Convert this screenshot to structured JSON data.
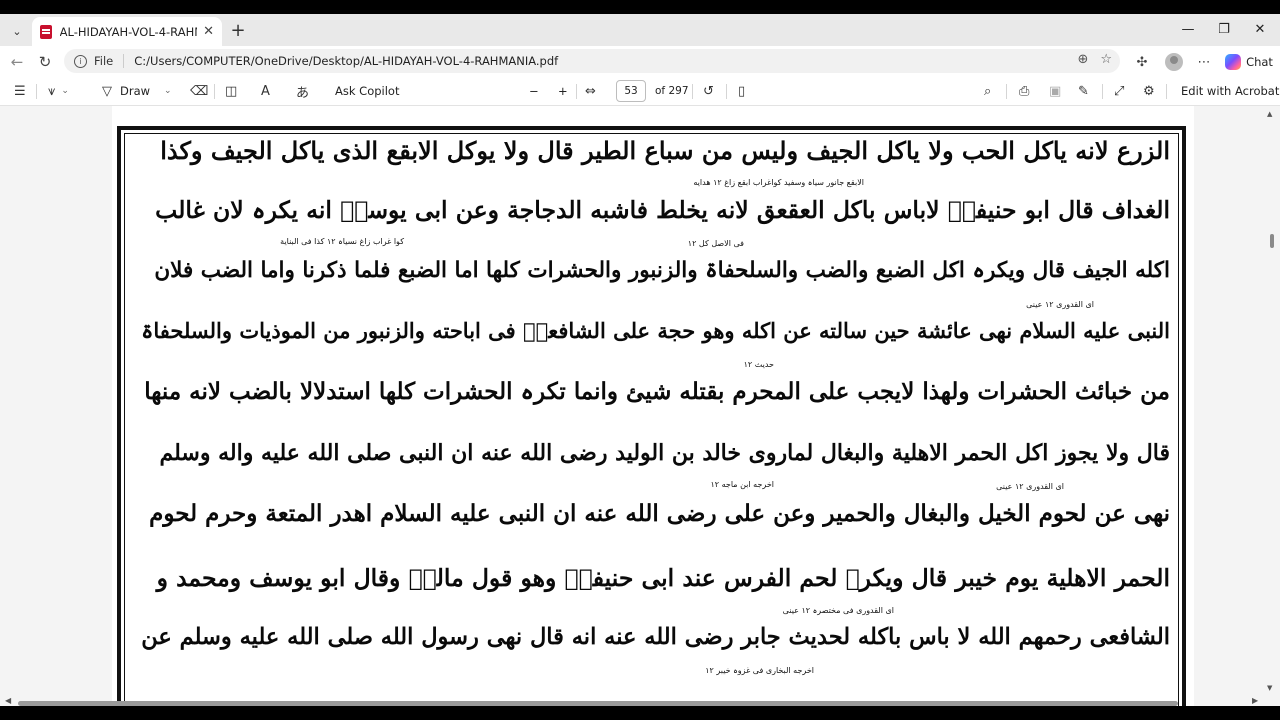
{
  "browser": {
    "tab_title": "AL-HIDAYAH-VOL-4-RAHMANIA.pdf",
    "tab_close": "✕",
    "new_tab": "+",
    "scheme_label": "File",
    "url": "C:/Users/COMPUTER/OneDrive/Desktop/AL-HIDAYAH-VOL-4-RAHMANIA.pdf",
    "chat_label": "Chat",
    "window_controls": {
      "minimize": "—",
      "maximize": "❐",
      "close": "✕"
    }
  },
  "pdf_toolbar": {
    "draw_label": "Draw",
    "ask_copilot_label": "Ask Copilot",
    "zoom_out": "−",
    "zoom_in": "+",
    "current_page": "53",
    "total_pages": "of 297",
    "edit_acrobat_label": "Edit with Acrobat"
  },
  "document": {
    "lines": [
      "الزرع لانه یاکل الحب ولا یاکل الجیف ولیس من سباع الطیر قال ولا یوکل الابقع الذی یاکل الجیف وکذا",
      "الغداف قال ابو حنیفہؒ لاباس باکل العقعق لانه یخلط فاشبه الدجاجة وعن ابی یوسفؒ انه یکرہ لان غالب",
      "اکله الجیف قال ویکرہ اکل الضبع والضب والسلحفاۃ والزنبور والحشرات کلها اما الضبع فلما ذکرنا واما الضب فلان",
      "النبی علیه السلام نهی عائشة حین سالته عن اکله وهو حجة علی الشافعیؒ فی اباحته والزنبور من الموذیات والسلحفاۃ",
      "من خبائث الحشرات ولهذا لایجب علی المحرم بقتله شیئ وانما تکرہ الحشرات کلها استدلالا بالضب لانه منها",
      "قال ولا یجوز اکل الحمر الاهلیة والبغال لماروی خالد بن الولید رضی الله عنه ان النبی صلی الله علیه واله وسلم",
      "نهی عن لحوم الخیل والبغال والحمیر وعن علی رضی الله عنه ان النبی علیه السلام اهدر المتعة وحرم لحوم",
      "الحمر الاهلیة یوم خیبر قال ویکرہ لحم الفرس عند ابی حنیفةؒ وهو قول مالکؒ وقال ابو یوسف ومحمد و",
      "الشافعی رحمهم الله لا باس باکله لحدیث جابر رضی الله عنه انه قال نهی رسول الله صلی الله علیه وسلم عن"
    ],
    "glosses": [
      "الابقع جانور سیاہ وسفید کواغراب ابقع زاغ ۱۲ هدایه",
      "کوا غراب زاغ نسیاہ ۱۲ کذا فی البنایة",
      "فی الاصل کل ۱۲",
      "ای القدوری ۱۲ عینی",
      "حدیث ۱۲",
      "اخرجه ابن ماجه ۱۲",
      "ای القدوری ۱۲ عینی",
      "ای القدوری فی مختصرہ ۱۲ عینی",
      "اخرجه البخاری فی غزوہ خیبر ۱۲"
    ]
  }
}
